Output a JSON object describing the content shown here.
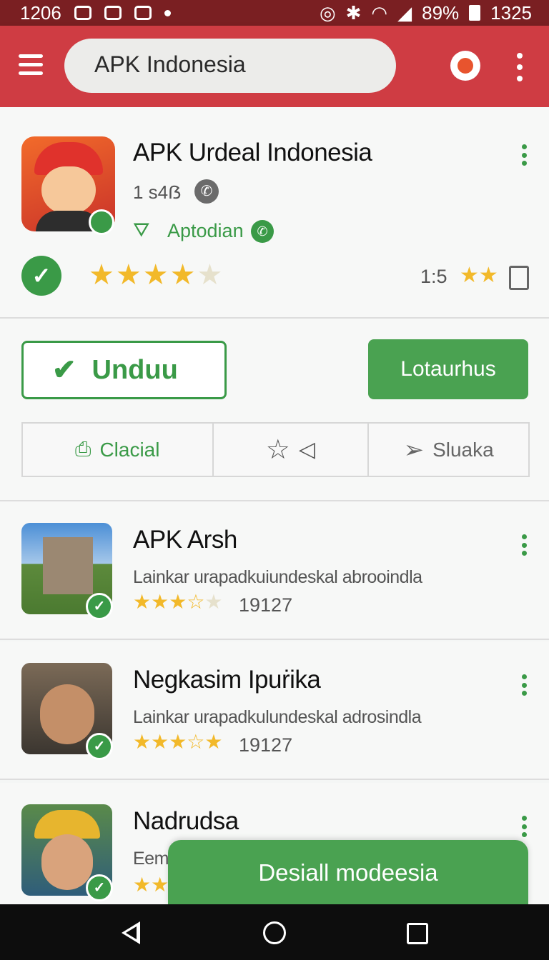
{
  "status_bar": {
    "left_time": "1206",
    "battery": "89%",
    "right_time": "1325"
  },
  "search": {
    "query": "APK Indonesia"
  },
  "featured": {
    "title": "APK Urdeal Indonesia",
    "size": "1 s4ẞ",
    "developer": "Aptodian",
    "stars_filled": 4,
    "stars_total": 5,
    "rating_text": "1:5",
    "small_stars": "★★"
  },
  "actions": {
    "download_label": "Unduu",
    "install_label": "Lotaurhus",
    "share_label": "Clacial",
    "save_label": "Sluaka"
  },
  "list": [
    {
      "title": "APK Arsh",
      "description": "Lainkar urapadkuiundeskal abrooindla",
      "count": "19127"
    },
    {
      "title": "Negkasim Ipuṙika",
      "description": "Lainkar urapadkulundeskal adrosindla",
      "count": "19127"
    },
    {
      "title": "Nadrudsa",
      "description": "Eem",
      "count": ""
    }
  ],
  "cta": {
    "label": "Desiall modeesia"
  },
  "colors": {
    "app_bar": "#cf3c43",
    "accent_green": "#3a9a47",
    "star": "#f2b92a"
  }
}
